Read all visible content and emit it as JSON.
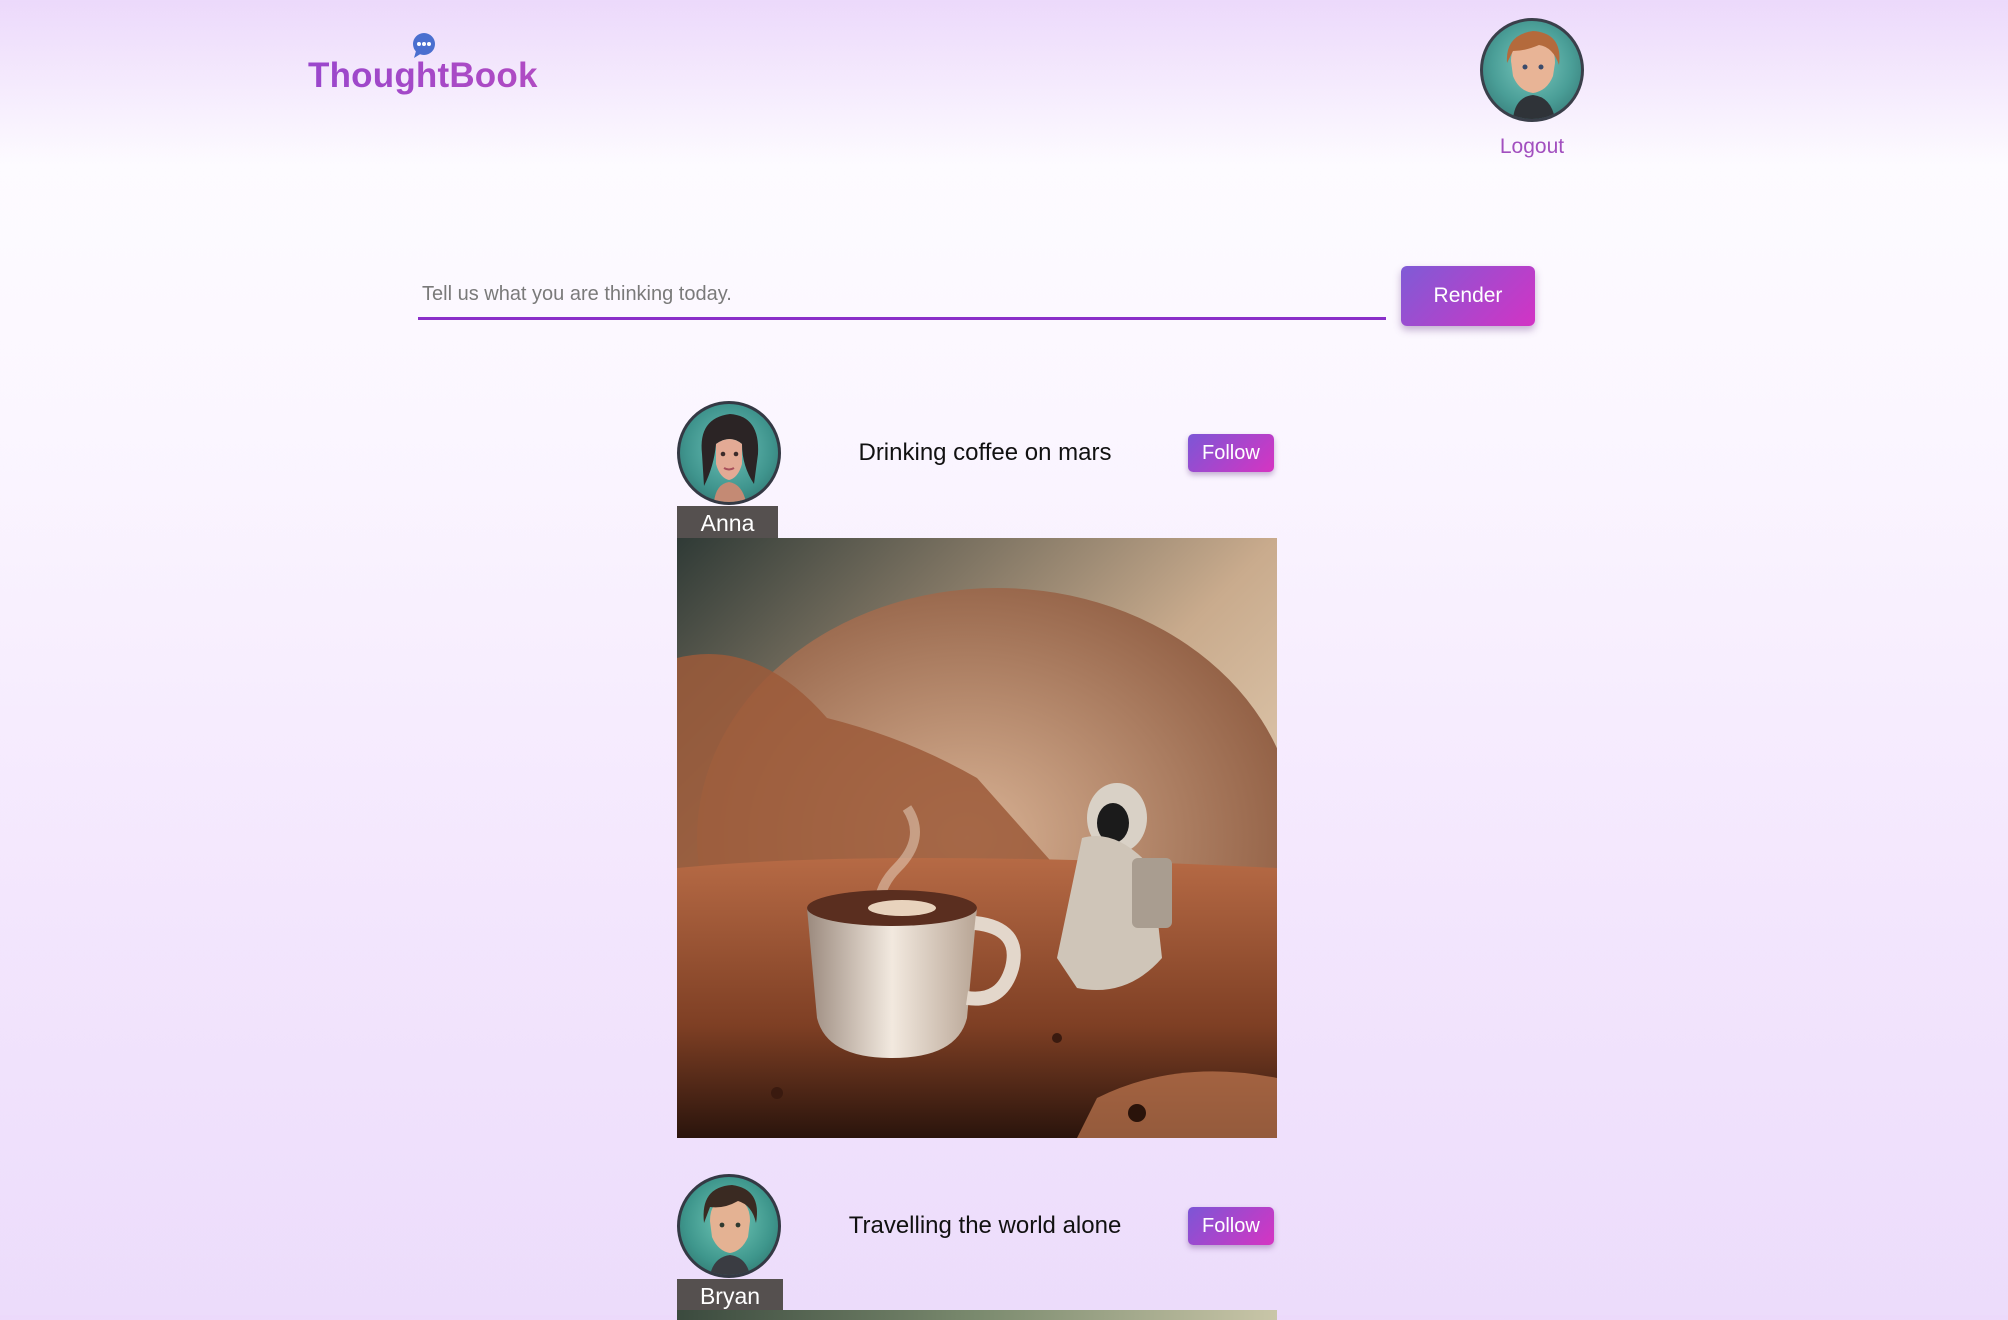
{
  "header": {
    "brand": "ThoughtBook",
    "logout_label": "Logout",
    "icons": {
      "logo": "chat-bubble-icon",
      "user_avatar": "user-avatar-portrait"
    }
  },
  "composer": {
    "placeholder": "Tell us what you are thinking today.",
    "value": "",
    "render_label": "Render"
  },
  "posts": [
    {
      "author": "Anna",
      "text": "Drinking coffee on mars",
      "follow_label": "Follow"
    },
    {
      "author": "Bryan",
      "text": "Travelling the world alone",
      "follow_label": "Follow"
    }
  ],
  "colors": {
    "brand": "#9a47cc",
    "button_gradient_start": "#7c56d6",
    "button_gradient_end": "#d634c2",
    "input_underline": "#8a2fc9"
  }
}
